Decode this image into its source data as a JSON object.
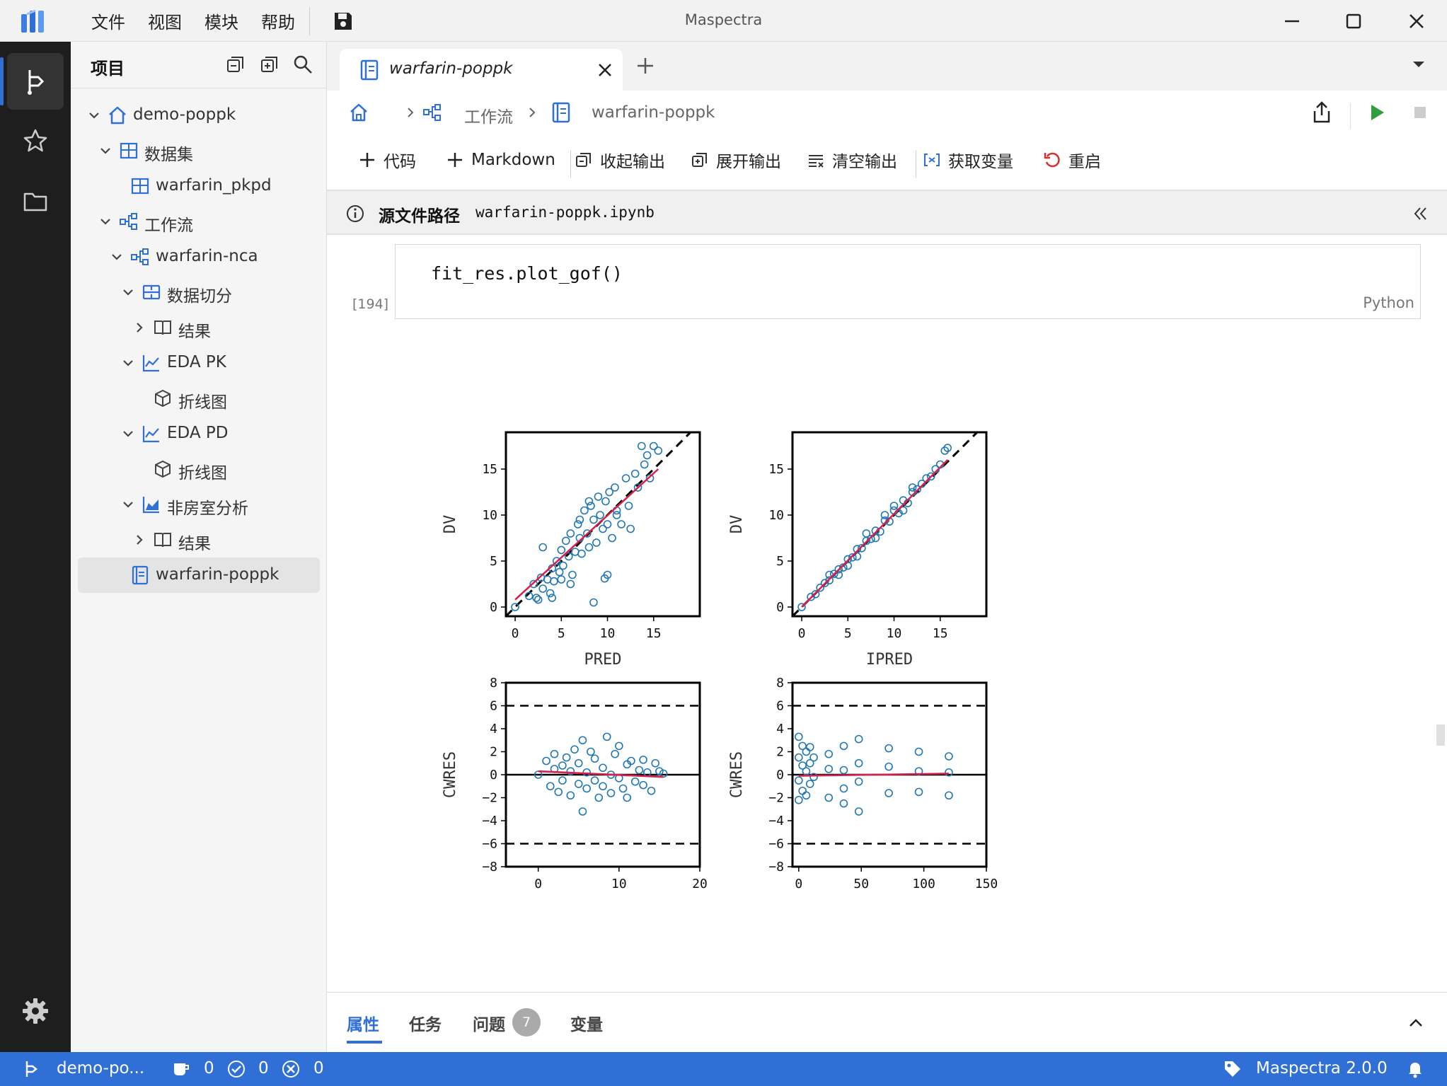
{
  "app": {
    "title": "Maspectra",
    "version_label": "Maspectra 2.0.0"
  },
  "menu": [
    "文件",
    "视图",
    "模块",
    "帮助"
  ],
  "sidebar": {
    "title": "项目",
    "tree": [
      {
        "label": "demo-poppk",
        "icon": "home-icon"
      },
      {
        "label": "数据集",
        "icon": "table-icon"
      },
      {
        "label": "warfarin_pkpd",
        "icon": "table-icon"
      },
      {
        "label": "工作流",
        "icon": "workflow-icon"
      },
      {
        "label": "warfarin-nca",
        "icon": "workflow-icon"
      },
      {
        "label": "数据切分",
        "icon": "split-icon"
      },
      {
        "label": "结果",
        "icon": "book-icon"
      },
      {
        "label": "EDA PK",
        "icon": "line-chart-icon"
      },
      {
        "label": "折线图",
        "icon": "cube-icon"
      },
      {
        "label": "EDA PD",
        "icon": "line-chart-icon"
      },
      {
        "label": "折线图",
        "icon": "cube-icon"
      },
      {
        "label": "非房室分析",
        "icon": "area-chart-icon"
      },
      {
        "label": "结果",
        "icon": "book-icon"
      },
      {
        "label": "warfarin-poppk",
        "icon": "notebook-icon"
      }
    ]
  },
  "tab": {
    "label": "warfarin-poppk"
  },
  "breadcrumb": {
    "workflow": "工作流",
    "notebook": "warfarin-poppk"
  },
  "toolbar": {
    "add_code": "代码",
    "add_markdown": "Markdown",
    "collapse_output": "收起输出",
    "expand_output": "展开输出",
    "clear_output": "清空输出",
    "get_variables": "获取变量",
    "restart": "重启"
  },
  "pathbar": {
    "label": "源文件路径",
    "value": "warfarin-poppk.ipynb"
  },
  "cell": {
    "code": "fit_res.plot_gof()",
    "language": "Python",
    "count": "[194]"
  },
  "panel": {
    "tabs": [
      "属性",
      "任务",
      "问题",
      "变量"
    ],
    "issues_count": "7"
  },
  "status": {
    "project": "demo-po...",
    "pending": "0",
    "ok": "0",
    "errors": "0"
  },
  "chart_data": [
    {
      "type": "scatter",
      "xlabel": "PRED",
      "ylabel": "DV",
      "xlim": [
        -1,
        20
      ],
      "ylim": [
        -1,
        19
      ],
      "xticks": [
        0,
        5,
        10,
        15
      ],
      "yticks": [
        0,
        5,
        10,
        15
      ],
      "reference_line": "identity",
      "trend": [
        [
          0,
          0.8
        ],
        [
          15.5,
          15
        ]
      ],
      "points": [
        [
          0,
          0
        ],
        [
          1.5,
          1.2
        ],
        [
          2,
          2.5
        ],
        [
          2.3,
          1
        ],
        [
          2.8,
          3.2
        ],
        [
          3,
          6.5
        ],
        [
          3.5,
          3
        ],
        [
          3.8,
          1.5
        ],
        [
          4,
          4.2
        ],
        [
          4.2,
          2.8
        ],
        [
          4.5,
          5
        ],
        [
          4.8,
          3.8
        ],
        [
          5,
          6.2
        ],
        [
          5.2,
          4.5
        ],
        [
          5.5,
          7.2
        ],
        [
          5.8,
          5.5
        ],
        [
          6,
          8
        ],
        [
          6.2,
          3.5
        ],
        [
          6.5,
          6
        ],
        [
          6.8,
          9
        ],
        [
          7,
          7.5
        ],
        [
          7.2,
          5.8
        ],
        [
          7.5,
          10.5
        ],
        [
          7.8,
          8
        ],
        [
          8,
          6.5
        ],
        [
          8.2,
          11
        ],
        [
          8.5,
          9.5
        ],
        [
          8.8,
          7
        ],
        [
          9,
          12
        ],
        [
          9.2,
          10
        ],
        [
          9.5,
          8.5
        ],
        [
          9.8,
          11.5
        ],
        [
          10,
          9
        ],
        [
          10.2,
          12.5
        ],
        [
          10.5,
          7.5
        ],
        [
          10.8,
          13
        ],
        [
          11,
          10.5
        ],
        [
          11.5,
          9
        ],
        [
          12,
          14
        ],
        [
          12.3,
          11
        ],
        [
          12.5,
          8.5
        ],
        [
          13,
          14.5
        ],
        [
          13.3,
          13
        ],
        [
          13.7,
          17.5
        ],
        [
          14,
          15.5
        ],
        [
          14.3,
          16.5
        ],
        [
          14.6,
          14
        ],
        [
          15,
          17.5
        ],
        [
          15.5,
          17
        ],
        [
          8.5,
          0.5
        ],
        [
          10,
          3.5
        ],
        [
          9.7,
          3.1
        ],
        [
          6,
          2.5
        ],
        [
          4,
          1
        ],
        [
          3,
          2
        ],
        [
          2.5,
          0.8
        ],
        [
          5,
          3
        ],
        [
          11,
          10
        ],
        [
          7,
          9.5
        ],
        [
          8,
          11.5
        ]
      ]
    },
    {
      "type": "scatter",
      "xlabel": "IPRED",
      "ylabel": "DV",
      "xlim": [
        -1,
        20
      ],
      "ylim": [
        -1,
        19
      ],
      "xticks": [
        0,
        5,
        10,
        15
      ],
      "yticks": [
        0,
        5,
        10,
        15
      ],
      "reference_line": "identity",
      "trend": [
        [
          0,
          0
        ],
        [
          15.8,
          16
        ]
      ],
      "points": [
        [
          0,
          0
        ],
        [
          1,
          1.1
        ],
        [
          1.5,
          1.4
        ],
        [
          2,
          2.1
        ],
        [
          2.5,
          2.6
        ],
        [
          3,
          2.9
        ],
        [
          3.5,
          3.6
        ],
        [
          4,
          4.1
        ],
        [
          4.5,
          4.3
        ],
        [
          5,
          5.2
        ],
        [
          5.5,
          5.4
        ],
        [
          6,
          6.3
        ],
        [
          6.5,
          6.4
        ],
        [
          7,
          7.2
        ],
        [
          7.5,
          7.4
        ],
        [
          8,
          8.3
        ],
        [
          8.5,
          8.2
        ],
        [
          9,
          9.4
        ],
        [
          9.5,
          9.3
        ],
        [
          10,
          10.5
        ],
        [
          10.5,
          10.2
        ],
        [
          11,
          11.6
        ],
        [
          11.5,
          11.3
        ],
        [
          12,
          12.5
        ],
        [
          12.5,
          12.8
        ],
        [
          13,
          13.4
        ],
        [
          13.5,
          14
        ],
        [
          14,
          14.2
        ],
        [
          14.5,
          15
        ],
        [
          15,
          15.5
        ],
        [
          15.5,
          17
        ],
        [
          15.8,
          17.3
        ],
        [
          3,
          3.5
        ],
        [
          6,
          5.5
        ],
        [
          8,
          7.5
        ],
        [
          9,
          10
        ],
        [
          10,
          11
        ],
        [
          11,
          10.5
        ],
        [
          12,
          13
        ],
        [
          7,
          8
        ],
        [
          5,
          4.5
        ],
        [
          4,
          3.5
        ]
      ]
    },
    {
      "type": "scatter",
      "xlabel": "",
      "ylabel": "CWRES",
      "xlim": [
        -4,
        20
      ],
      "ylim": [
        -8,
        8
      ],
      "xticks": [
        0,
        10,
        20
      ],
      "yticks": [
        -8,
        -6,
        -4,
        -2,
        0,
        2,
        4,
        6,
        8
      ],
      "reference_lines": [
        -6,
        0,
        6
      ],
      "trend": [
        [
          0,
          0.3
        ],
        [
          15.5,
          -0.2
        ]
      ],
      "points": [
        [
          0,
          0
        ],
        [
          1,
          1.2
        ],
        [
          1.5,
          -1
        ],
        [
          2,
          0.5
        ],
        [
          2,
          1.8
        ],
        [
          2.5,
          -1.5
        ],
        [
          3,
          0.8
        ],
        [
          3,
          -0.5
        ],
        [
          3.5,
          1.5
        ],
        [
          4,
          -1.8
        ],
        [
          4,
          0.3
        ],
        [
          4.5,
          2.2
        ],
        [
          5,
          -0.8
        ],
        [
          5,
          1
        ],
        [
          5.5,
          3
        ],
        [
          5.5,
          -3.2
        ],
        [
          6,
          0.2
        ],
        [
          6,
          -1.2
        ],
        [
          6.5,
          2
        ],
        [
          7,
          -0.5
        ],
        [
          7,
          1.4
        ],
        [
          7.5,
          -2
        ],
        [
          8,
          0.6
        ],
        [
          8,
          -1
        ],
        [
          8.5,
          3.3
        ],
        [
          9,
          0
        ],
        [
          9,
          -1.6
        ],
        [
          9.5,
          1.8
        ],
        [
          10,
          -0.3
        ],
        [
          10,
          2.5
        ],
        [
          10.5,
          -1.2
        ],
        [
          11,
          0.9
        ],
        [
          11,
          -2
        ],
        [
          11.5,
          1.2
        ],
        [
          12,
          -0.6
        ],
        [
          12.5,
          0.4
        ],
        [
          13,
          -0.9
        ],
        [
          13,
          1.3
        ],
        [
          13.5,
          0.2
        ],
        [
          14,
          -1.4
        ],
        [
          14.5,
          1
        ],
        [
          15,
          0.3
        ],
        [
          15.5,
          0.1
        ]
      ]
    },
    {
      "type": "scatter",
      "xlabel": "",
      "ylabel": "CWRES",
      "xlim": [
        -5,
        150
      ],
      "ylim": [
        -8,
        8
      ],
      "xticks": [
        0,
        50,
        100,
        150
      ],
      "yticks": [
        -8,
        -6,
        -4,
        -2,
        0,
        2,
        4,
        6,
        8
      ],
      "reference_lines": [
        -6,
        0,
        6
      ],
      "trend": [
        [
          0,
          -0.1
        ],
        [
          120,
          0.1
        ]
      ],
      "time_points": [
        0,
        3,
        6,
        9,
        12,
        24,
        36,
        48,
        72,
        96,
        120
      ],
      "points": [
        [
          0,
          3.3
        ],
        [
          0,
          1.5
        ],
        [
          0,
          -0.5
        ],
        [
          0,
          -2.2
        ],
        [
          3,
          2.5
        ],
        [
          3,
          0.8
        ],
        [
          3,
          -1.4
        ],
        [
          6,
          2
        ],
        [
          6,
          0.3
        ],
        [
          6,
          -1.8
        ],
        [
          9,
          2.4
        ],
        [
          9,
          1
        ],
        [
          9,
          -0.8
        ],
        [
          12,
          1.5
        ],
        [
          12,
          -0.2
        ],
        [
          24,
          1.8
        ],
        [
          24,
          0.5
        ],
        [
          24,
          -2
        ],
        [
          36,
          2.5
        ],
        [
          36,
          0.4
        ],
        [
          36,
          -1.2
        ],
        [
          36,
          -2.5
        ],
        [
          48,
          3.1
        ],
        [
          48,
          1
        ],
        [
          48,
          -0.6
        ],
        [
          48,
          -3.2
        ],
        [
          72,
          2.3
        ],
        [
          72,
          0.7
        ],
        [
          72,
          -1.6
        ],
        [
          96,
          2
        ],
        [
          96,
          0.3
        ],
        [
          96,
          -1.5
        ],
        [
          120,
          1.6
        ],
        [
          120,
          0.2
        ],
        [
          120,
          -1.8
        ]
      ]
    }
  ]
}
